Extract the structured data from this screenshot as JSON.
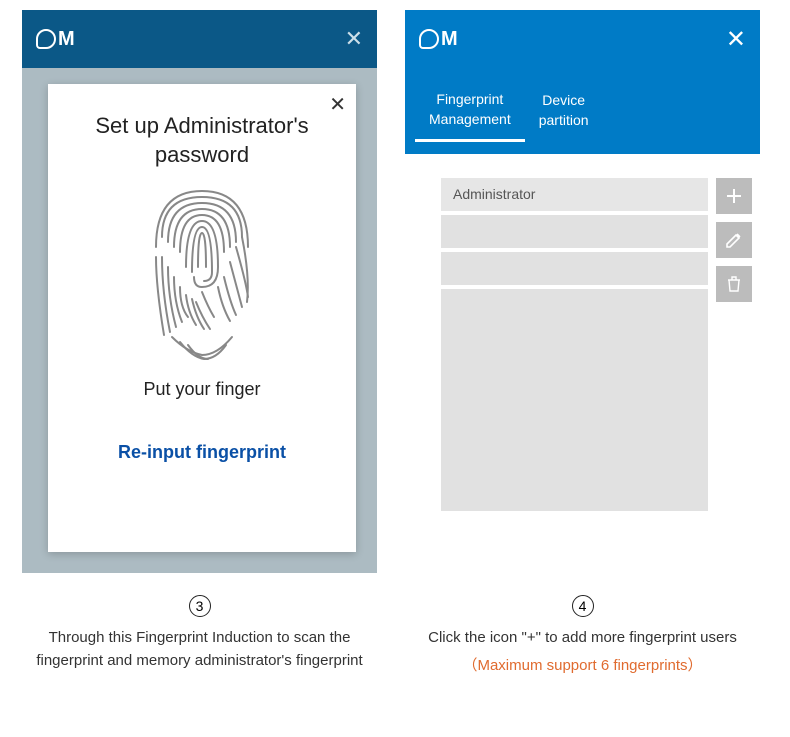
{
  "panel3": {
    "modal_title": "Set up  Administrator's password",
    "put_finger": "Put your  finger",
    "reinput": "Re-input fingerprint"
  },
  "panel4": {
    "tab1": "Fingerprint\nManagement",
    "tab2": "Device\npartition",
    "user_rows": [
      "Administrator",
      "",
      ""
    ]
  },
  "captions": {
    "step3_num": "3",
    "step3_text": "Through this  Fingerprint Induction to scan the fingerprint and memory administrator's fingerprint",
    "step4_num": "4",
    "step4_text": "Click  the icon \"+\" to add more fingerprint users",
    "step4_note": "（Maximum support 6 fingerprints）"
  }
}
